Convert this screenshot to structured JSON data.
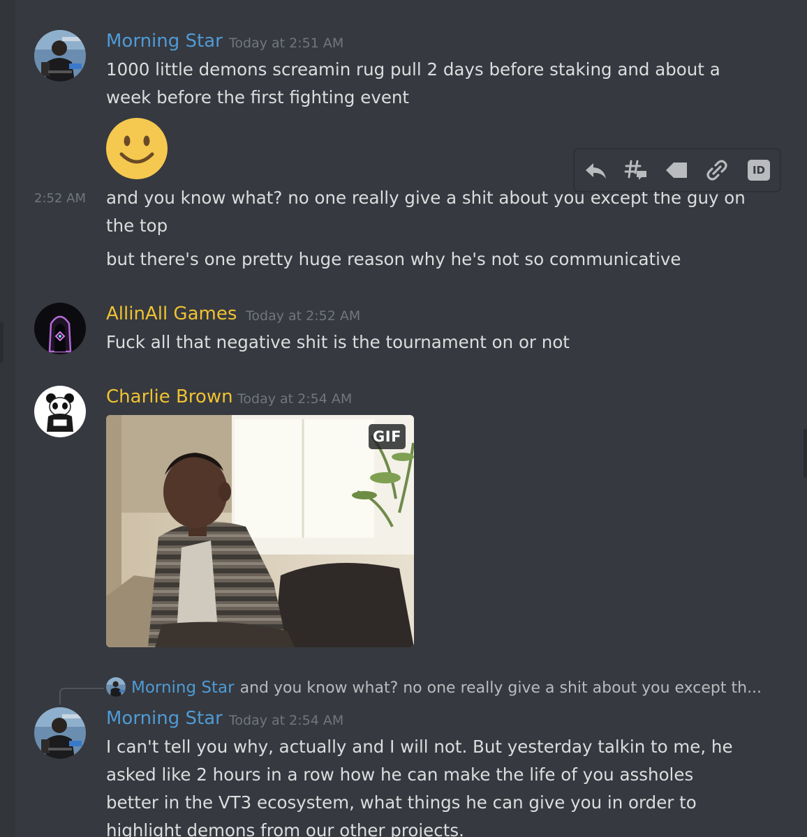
{
  "colors": {
    "background": "#36393f",
    "name_blue": "#4f9bd6",
    "name_gold": "#f0c232",
    "timestamp": "#72767d",
    "message_text": "#dcddde"
  },
  "messages": [
    {
      "author": "Morning Star",
      "timestamp": "Today at 2:51 AM",
      "name_color": "#4f9bd6",
      "lines": [
        "1000 little demons screamin rug pull 2 days before staking and about a",
        "week before the first fighting event"
      ],
      "emoji": "slightly-smiling-face",
      "followups": [
        {
          "hover_time": "2:52 AM",
          "lines": [
            "and you know what? no one really give a shit about you except the guy on",
            "the top"
          ]
        },
        {
          "lines": [
            "but there's one pretty huge reason why he's not so communicative"
          ]
        }
      ]
    },
    {
      "author": "AllinAll Games",
      "timestamp": "Today at 2:52 AM",
      "name_color": "#f0c232",
      "lines": [
        "Fuck all that negative shit is the tournament on or not"
      ]
    },
    {
      "author": "Charlie Brown",
      "timestamp": "Today at 2:54 AM",
      "name_color": "#f0c232",
      "attachment": {
        "badge": "GIF",
        "icon": "gif-image"
      }
    },
    {
      "author": "Morning Star",
      "timestamp": "Today at 2:54 AM",
      "name_color": "#4f9bd6",
      "reply": {
        "author": "Morning Star",
        "preview": "and you know what? no one really give a shit about you except th..."
      },
      "lines": [
        "I can't tell you why, actually and I will not. But yesterday talkin to me, he",
        "asked like 2 hours in a row how he can make the life of you assholes",
        "better in the VT3 ecosystem, what things he can give you in order to",
        "highlight demons from our other projects."
      ]
    }
  ],
  "toolbar": {
    "buttons": [
      "reply-icon",
      "create-thread-icon",
      "tag-icon",
      "copy-link-icon",
      "copy-id-icon"
    ],
    "id_label": "ID"
  }
}
